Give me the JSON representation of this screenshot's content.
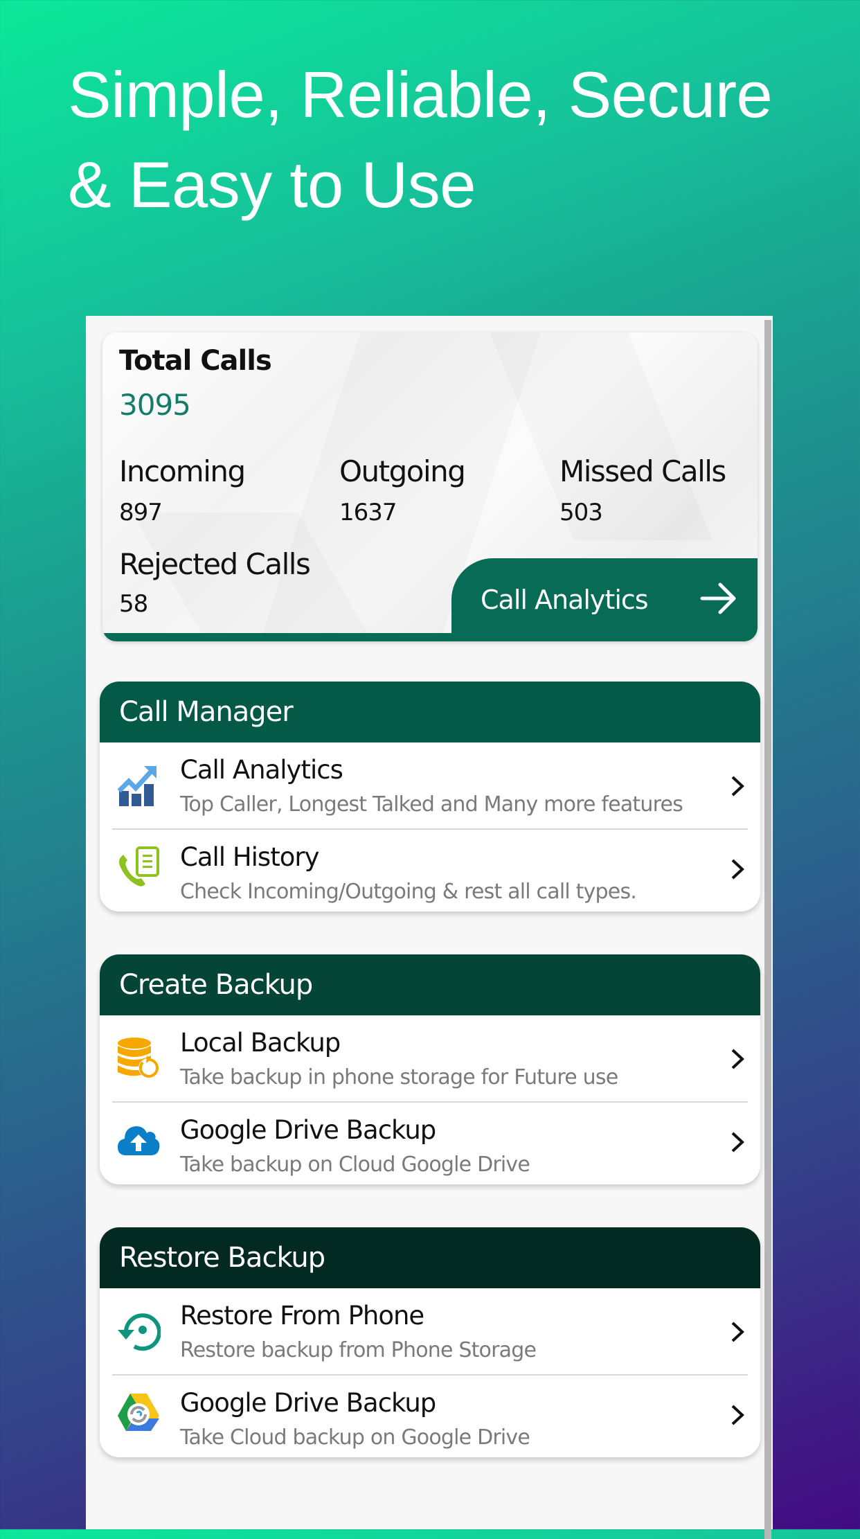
{
  "headline": {
    "line1": "Simple, Reliable, Secure",
    "line2": "& Easy to Use"
  },
  "stats": {
    "total_label": "Total Calls",
    "total_value": "3095",
    "incoming_label": "Incoming",
    "incoming_value": "897",
    "outgoing_label": "Outgoing",
    "outgoing_value": "1637",
    "missed_label": "Missed Calls",
    "missed_value": "503",
    "rejected_label": "Rejected Calls",
    "rejected_value": "58",
    "analytics_button": "Call Analytics",
    "analytics_icon": "arrow-right-icon"
  },
  "sections": [
    {
      "header": "Call Manager",
      "color": "#045a47",
      "items": [
        {
          "title": "Call Analytics",
          "subtitle": "Top Caller, Longest Talked and Many more features",
          "icon": "chart-growth-icon"
        },
        {
          "title": "Call History",
          "subtitle": "Check Incoming/Outgoing & rest all call types.",
          "icon": "phone-document-icon"
        }
      ]
    },
    {
      "header": "Create Backup",
      "color": "#044537",
      "items": [
        {
          "title": "Local Backup",
          "subtitle": "Take backup in phone storage for Future use",
          "icon": "database-restore-icon"
        },
        {
          "title": "Google Drive Backup",
          "subtitle": "Take backup on Cloud Google Drive",
          "icon": "cloud-upload-icon"
        }
      ]
    },
    {
      "header": "Restore Backup",
      "color": "#032a22",
      "items": [
        {
          "title": "Restore From Phone",
          "subtitle": "Restore backup from Phone Storage",
          "icon": "restore-icon"
        },
        {
          "title": "Google Drive Backup",
          "subtitle": "Take Cloud backup on Google Drive",
          "icon": "google-drive-sync-icon"
        }
      ]
    }
  ],
  "colors": {
    "accent_green": "#086b55",
    "total_value_color": "#137d68",
    "subtitle_gray": "#7a7a7a"
  }
}
